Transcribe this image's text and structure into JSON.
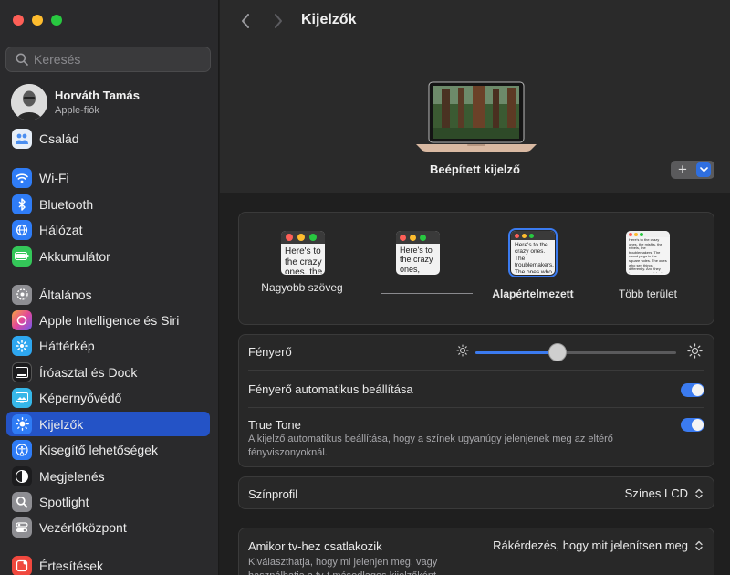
{
  "window": {
    "title": "Kijelzők"
  },
  "search": {
    "placeholder": "Keresés"
  },
  "profile": {
    "name": "Horváth Tamás",
    "subtitle": "Apple-fiók"
  },
  "sidebar": {
    "items": [
      {
        "label": "Család",
        "icon": "family-icon",
        "color": "#e6eef8"
      },
      {
        "label": "Wi-Fi",
        "icon": "wifi-icon",
        "color": "#2f7cf6"
      },
      {
        "label": "Bluetooth",
        "icon": "bluetooth-icon",
        "color": "#2f7cf6"
      },
      {
        "label": "Hálózat",
        "icon": "globe-icon",
        "color": "#2f7cf6"
      },
      {
        "label": "Akkumulátor",
        "icon": "battery-icon",
        "color": "#34c759"
      },
      {
        "label": "Általános",
        "icon": "gear-icon",
        "color": "#8e8e93"
      },
      {
        "label": "Apple Intelligence és Siri",
        "icon": "siri-icon",
        "color": "#d45acb"
      },
      {
        "label": "Háttérkép",
        "icon": "wallpaper-icon",
        "color": "#2ea7f0"
      },
      {
        "label": "Íróasztal és Dock",
        "icon": "dock-icon",
        "color": "#1c1c1e"
      },
      {
        "label": "Képernyővédő",
        "icon": "screensaver-icon",
        "color": "#36b7e8"
      },
      {
        "label": "Kijelzők",
        "icon": "brightness-icon",
        "color": "#2f7cf6",
        "active": true
      },
      {
        "label": "Kisegítő lehetőségek",
        "icon": "accessibility-icon",
        "color": "#2f7cf6"
      },
      {
        "label": "Megjelenés",
        "icon": "appearance-icon",
        "color": "#1c1c1e"
      },
      {
        "label": "Spotlight",
        "icon": "magnifier-icon",
        "color": "#8e8e93"
      },
      {
        "label": "Vezérlőközpont",
        "icon": "control-center-icon",
        "color": "#8e8e93"
      },
      {
        "label": "Értesítések",
        "icon": "notifications-icon",
        "color": "#f0483e"
      }
    ]
  },
  "header": {
    "display_name": "Beépített kijelző",
    "add_label": "+"
  },
  "resolutions": [
    {
      "label": "Nagyobb szöveg",
      "sample": "Here's to the crazy ones, the misfits, troublemakers"
    },
    {
      "label": "",
      "sample": "Here's to the crazy ones, troublemakers, ones who see"
    },
    {
      "label": "Alapértelmezett",
      "sample": "Here's to the crazy ones. The troublemakers. The ones who see things differently. They're not fond of rules. And they",
      "selected": true
    },
    {
      "label": "Több terület",
      "sample": "Here's to the crazy ones, the misfits, the rebels, the troublemakers. The round pegs in the square holes. The ones who see things differently. And they have no respect for the status quo. About the only thing you can't do is ignore them. Because they change"
    }
  ],
  "settings": {
    "brightness_label": "Fényerő",
    "brightness_value": 0.41,
    "auto_brightness_label": "Fényerő automatikus beállítása",
    "auto_brightness_on": true,
    "true_tone_label": "True Tone",
    "true_tone_desc": "A kijelző automatikus beállítása, hogy a színek ugyanúgy jelenjenek meg az eltérő fényviszonyoknál.",
    "true_tone_on": true
  },
  "color_profile": {
    "label": "Színprofil",
    "value": "Színes LCD"
  },
  "tv": {
    "label": "Amikor tv-hez csatlakozik",
    "value": "Rákérdezés, hogy mit jelenítsen meg",
    "desc": "Kiválaszthatja, hogy mi jelenjen meg, vagy használhatja a tv-t másodlagos kijelzőként."
  },
  "colors": {
    "accent": "#3b7bf0",
    "sidebar_active": "#2453c6"
  }
}
